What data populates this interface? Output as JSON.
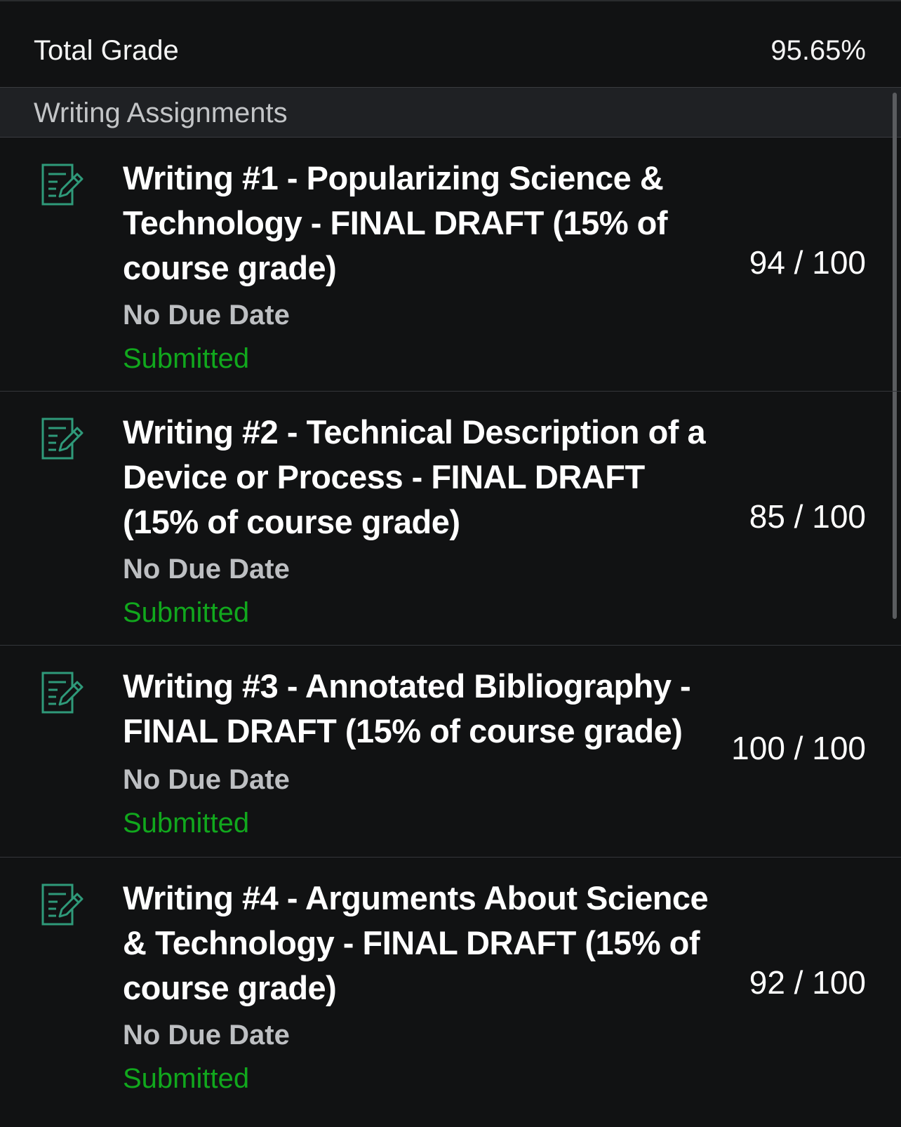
{
  "total": {
    "label": "Total Grade",
    "value": "95.65%"
  },
  "group": {
    "label": "Writing Assignments"
  },
  "assignments": [
    {
      "title": "Writing #1 - Popularizing Science & Technology - FINAL DRAFT (15% of course grade)",
      "due": "No Due Date",
      "status": "Submitted",
      "score": "94 / 100"
    },
    {
      "title": "Writing #2 - Technical Description of a Device or Process - FINAL DRAFT (15% of course grade)",
      "due": "No Due Date",
      "status": "Submitted",
      "score": "85 / 100"
    },
    {
      "title": "Writing #3 - Annotated Bibliography - FINAL DRAFT (15% of course grade)",
      "due": "No Due Date",
      "status": "Submitted",
      "score": "100 / 100"
    },
    {
      "title": "Writing #4 - Arguments About Science & Technology - FINAL DRAFT (15% of course grade)",
      "due": "No Due Date",
      "status": "Submitted",
      "score": "92 / 100"
    }
  ],
  "colors": {
    "background": "#111213",
    "status_submitted": "#11a81d",
    "icon": "#2f9a7a"
  },
  "icons": {
    "assignment": "assignment-edit-icon"
  }
}
